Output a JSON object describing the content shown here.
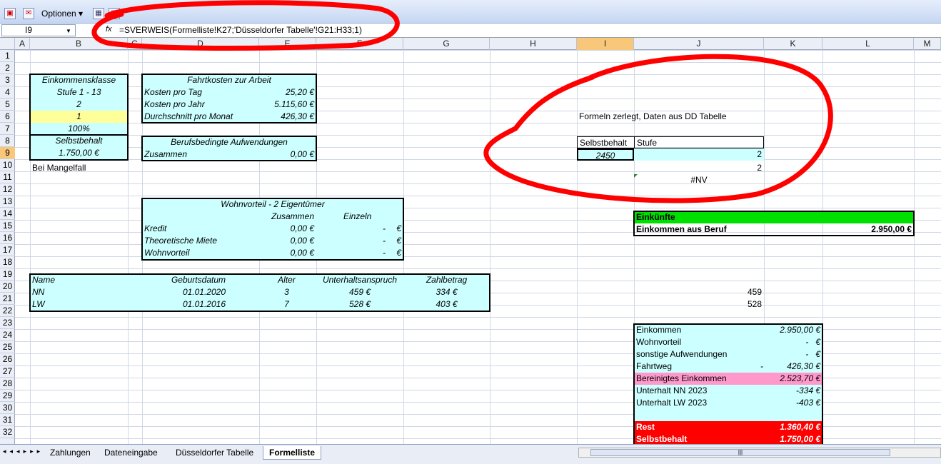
{
  "toolbar": {
    "options_label": "Optionen ▾"
  },
  "formula_bar": {
    "name_box": "I9",
    "fx": "fx",
    "formula": "=SVERWEIS(Formelliste!K27;'Düsseldorfer Tabelle'!G21:H33;1)"
  },
  "columns": [
    "A",
    "B",
    "C",
    "D",
    "E",
    "F",
    "G",
    "H",
    "I",
    "J",
    "K",
    "L",
    "M"
  ],
  "rows": [
    "1",
    "2",
    "3",
    "4",
    "5",
    "6",
    "7",
    "8",
    "9",
    "10",
    "11",
    "12",
    "13",
    "14",
    "15",
    "16",
    "17",
    "18",
    "19",
    "20",
    "21",
    "22",
    "23",
    "24",
    "25",
    "26",
    "27",
    "28",
    "29",
    "30",
    "31",
    "32"
  ],
  "einkommensklasse": {
    "title": "Einkommensklasse",
    "stufe": "Stufe 1 - 13",
    "value1": "2",
    "value2": "1",
    "percent": "100%",
    "selbstbehalt_label": "Selbstbehalt",
    "selbstbehalt_value": "1.750,00 €",
    "mangelfall": "Bei Mangelfall"
  },
  "fahrtkosten": {
    "title": "Fahrtkosten zur Arbeit",
    "rows": [
      {
        "label": "Kosten pro Tag",
        "value": "25,20 €"
      },
      {
        "label": "Kosten pro Jahr",
        "value": "5.115,60 €"
      },
      {
        "label": "Durchschnitt pro Monat",
        "value": "426,30 €"
      }
    ]
  },
  "berufsbedingt": {
    "title": "Berufsbedingte Aufwendungen",
    "label": "Zusammen",
    "value": "0,00 €"
  },
  "wohnvorteil": {
    "title": "Wohnvorteil - 2 Eigentümer",
    "col_zusammen": "Zusammen",
    "col_einzeln": "Einzeln",
    "rows": [
      {
        "label": "Kredit",
        "zusammen": "0,00 €",
        "einzeln": "-",
        "cur": "€"
      },
      {
        "label": "Theoretische Miete",
        "zusammen": "0,00 €",
        "einzeln": "-",
        "cur": "€"
      },
      {
        "label": "Wohnvorteil",
        "zusammen": "0,00 €",
        "einzeln": "-",
        "cur": "€"
      }
    ]
  },
  "kinder": {
    "headers": [
      "Name",
      "Geburtsdatum",
      "Alter",
      "Unterhaltsanspruch",
      "Zahlbetrag"
    ],
    "rows": [
      [
        "NN",
        "01.01.2020",
        "3",
        "459 €",
        "334 €"
      ],
      [
        "LW",
        "01.01.2016",
        "7",
        "528 €",
        "403 €"
      ]
    ]
  },
  "dd_area": {
    "note": "Formeln zerlegt, Daten aus DD Tabelle",
    "selbstbehalt_header": "Selbstbehalt",
    "stufe_header": "Stufe",
    "selbstbehalt_value": "2450",
    "stufe_value": "2",
    "j10": "2",
    "j11": "#NV"
  },
  "einkuenfte": {
    "title": "Einkünfte",
    "label": "Einkommen aus Beruf",
    "value": "2.950,00 €"
  },
  "k_values": {
    "k20": "459",
    "k21": "528"
  },
  "summary": {
    "rows": [
      {
        "label": "Einkommen",
        "prefix": "",
        "value": "2.950,00 €"
      },
      {
        "label": "Wohnvorteil",
        "prefix": "",
        "value": "-   €"
      },
      {
        "label": "sonstige Aufwendungen",
        "prefix": "",
        "value": "-   €"
      },
      {
        "label": "Fahrtweg",
        "prefix": "-",
        "value": "426,30 €"
      },
      {
        "label": "Bereinigtes Einkommen",
        "prefix": "",
        "value": "2.523,70 €"
      },
      {
        "label": "Unterhalt NN 2023",
        "prefix": "",
        "value": "-334 €"
      },
      {
        "label": "Unterhalt LW 2023",
        "prefix": "",
        "value": "-403 €"
      },
      {
        "label": "",
        "prefix": "",
        "value": ""
      },
      {
        "label": "Rest",
        "prefix": "",
        "value": "1.360,40 €"
      },
      {
        "label": "Selbstbehalt",
        "prefix": "",
        "value": "1.750,00 €"
      }
    ]
  },
  "tabs": [
    "Zahlungen",
    "Dateneingabe",
    "Düsseldorfer Tabelle",
    "Formelliste"
  ],
  "colors": {
    "cyan": "#ccffff",
    "yellow": "#ffff99",
    "green": "#00e000",
    "pink": "#ff99cc",
    "red": "#ff0000",
    "annotation": "#ff0000"
  }
}
